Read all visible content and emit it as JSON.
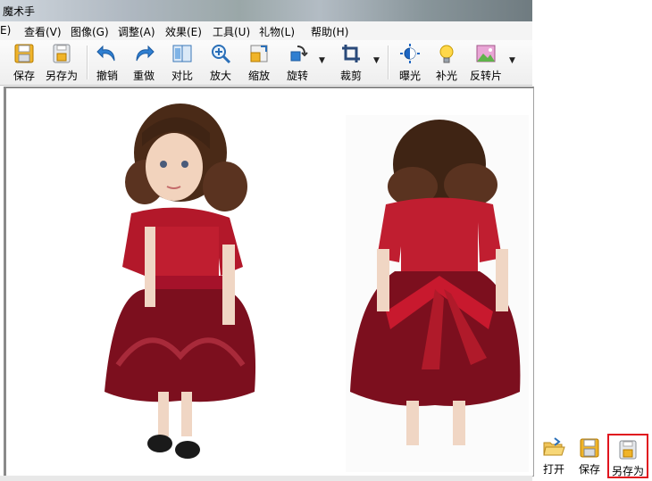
{
  "window": {
    "title": "魔术手"
  },
  "menu": [
    {
      "label": "E)"
    },
    {
      "label": "查看(V)"
    },
    {
      "label": "图像(G)"
    },
    {
      "label": "调整(A)"
    },
    {
      "label": "效果(E)"
    },
    {
      "label": "工具(U)"
    },
    {
      "label": "礼物(L)"
    },
    {
      "label": "帮助(H)"
    }
  ],
  "toolbar": {
    "save": "保存",
    "save_as": "另存为",
    "undo": "撤销",
    "redo": "重做",
    "compare": "对比",
    "zoom_in": "放大",
    "resize": "缩放",
    "rotate": "旋转",
    "crop": "裁剪",
    "exposure": "曝光",
    "fill_light": "补光",
    "invert": "反转片"
  },
  "mini_toolbar": {
    "open": "打开",
    "save": "保存",
    "save_as": "另存为"
  },
  "colors": {
    "accent_highlight": "#e0141e",
    "dress_red": "#b01a2a"
  },
  "icons": [
    "save-icon",
    "save-as-icon",
    "undo-icon",
    "redo-icon",
    "compare-icon",
    "zoom-in-icon",
    "resize-icon",
    "rotate-icon",
    "crop-icon",
    "exposure-icon",
    "fill-light-icon",
    "invert-icon",
    "folder-open-icon"
  ]
}
